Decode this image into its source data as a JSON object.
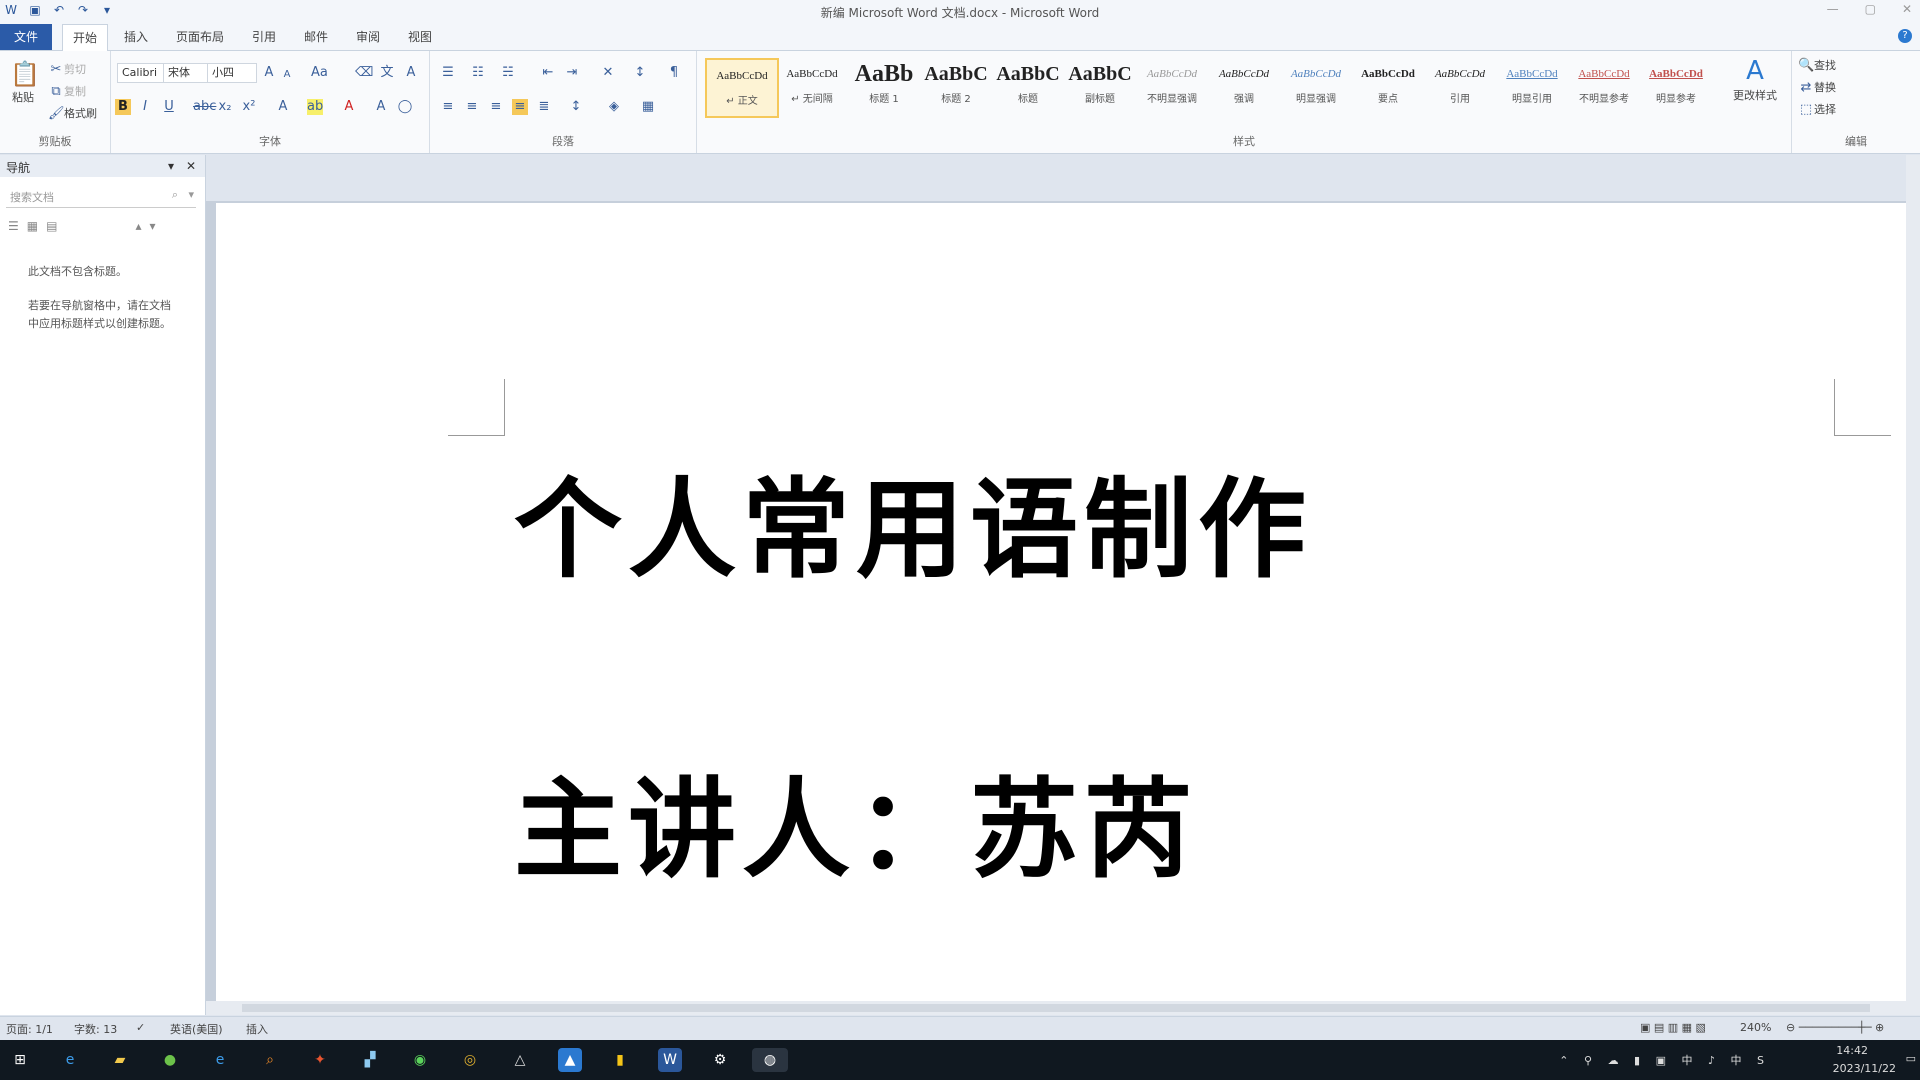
{
  "window": {
    "title": "新编 Microsoft Word 文档.docx - Microsoft Word"
  },
  "qat": {
    "word_icon": "W",
    "save_icon": "▣",
    "undo_icon": "↶",
    "redo_icon": "↷",
    "more_icon": "▾"
  },
  "tabs": [
    "文件",
    "开始",
    "插入",
    "页面布局",
    "引用",
    "邮件",
    "审阅",
    "视图"
  ],
  "ribbon": {
    "clipboard": {
      "paste": "粘贴",
      "cut": "剪切",
      "copy": "复制",
      "format_painter": "格式刷",
      "group_label": "剪贴板"
    },
    "font": {
      "font_name": "Calibri",
      "font_asian": "宋体",
      "font_size": "小四",
      "group_label": "字体"
    },
    "paragraph": {
      "group_label": "段落"
    },
    "styles": {
      "items": [
        {
          "preview": "AaBbCcDd",
          "name": "↵ 正文"
        },
        {
          "preview": "AaBbCcDd",
          "name": "↵ 无间隔"
        },
        {
          "preview": "AaBb",
          "name": "标题 1"
        },
        {
          "preview": "AaBbC",
          "name": "标题 2"
        },
        {
          "preview": "AaBbC",
          "name": "标题"
        },
        {
          "preview": "AaBbC",
          "name": "副标题"
        },
        {
          "preview": "AaBbCcDd",
          "name": "不明显强调"
        },
        {
          "preview": "AaBbCcDd",
          "name": "强调"
        },
        {
          "preview": "AaBbCcDd",
          "name": "明显强调"
        },
        {
          "preview": "AaBbCcDd",
          "name": "要点"
        },
        {
          "preview": "AaBbCcDd",
          "name": "引用"
        },
        {
          "preview": "AaBbCcDd",
          "name": "明显引用"
        },
        {
          "preview": "AaBbCcDd",
          "name": "不明显参考"
        },
        {
          "preview": "AaBbCcDd",
          "name": "明显参考"
        }
      ],
      "change_styles": "更改样式",
      "group_label": "样式"
    },
    "editing": {
      "find": "查找",
      "replace": "替换",
      "select": "选择",
      "group_label": "编辑"
    }
  },
  "nav": {
    "title": "导航",
    "search_placeholder": "搜索文档",
    "message1": "此文档不包含标题。",
    "message2": "若要在导航窗格中，请在文档中应用标题样式以创建标题。"
  },
  "document": {
    "title_line": "个人常用语制作",
    "speaker_line": "主讲人：苏芮"
  },
  "status": {
    "page": "页面: 1/1",
    "words": "字数: 13",
    "language": "英语(美国)",
    "mode": "插入",
    "zoom": "240%"
  },
  "tray": {
    "time": "14:42",
    "date": "2023/11/22"
  }
}
